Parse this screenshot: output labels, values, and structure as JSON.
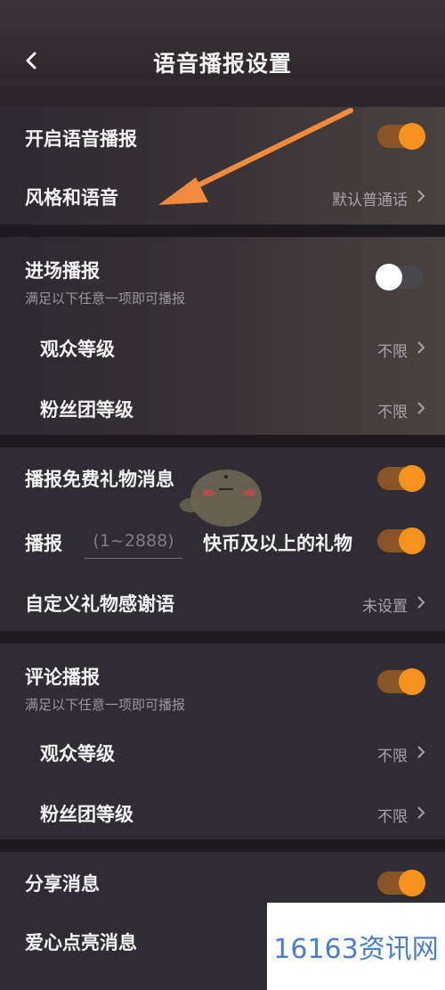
{
  "header": {
    "title": "语音播报设置",
    "back_icon": "chevron-left-icon"
  },
  "section1": {
    "voice_broadcast_label": "开启语音播报",
    "voice_broadcast_on": true,
    "style_label": "风格和语音",
    "style_value": "默认普通话"
  },
  "section2": {
    "entry_label": "进场播报",
    "entry_on": false,
    "entry_hint": "满足以下任意一项即可播报",
    "audience_label": "观众等级",
    "audience_value": "不限",
    "fan_label": "粉丝团等级",
    "fan_value": "不限"
  },
  "section3": {
    "free_gift_label": "播报免费礼物消息",
    "free_gift_on": true,
    "broadcast_prefix": "播报",
    "range_placeholder": "(1~2888)",
    "broadcast_suffix": "快币及以上的礼物",
    "paid_gift_on": true,
    "custom_thanks_label": "自定义礼物感谢语",
    "custom_thanks_value": "未设置"
  },
  "section4": {
    "comment_label": "评论播报",
    "comment_on": true,
    "comment_hint": "满足以下任意一项即可播报",
    "audience_label": "观众等级",
    "audience_value": "不限",
    "fan_label": "粉丝团等级",
    "fan_value": "不限"
  },
  "section5": {
    "share_label": "分享消息",
    "share_on": true,
    "partial_label": "爱心点亮消息"
  },
  "watermark": {
    "text": "16163资讯网"
  },
  "colors": {
    "accent": "#f6921e",
    "arrow": "#f08a3c"
  }
}
